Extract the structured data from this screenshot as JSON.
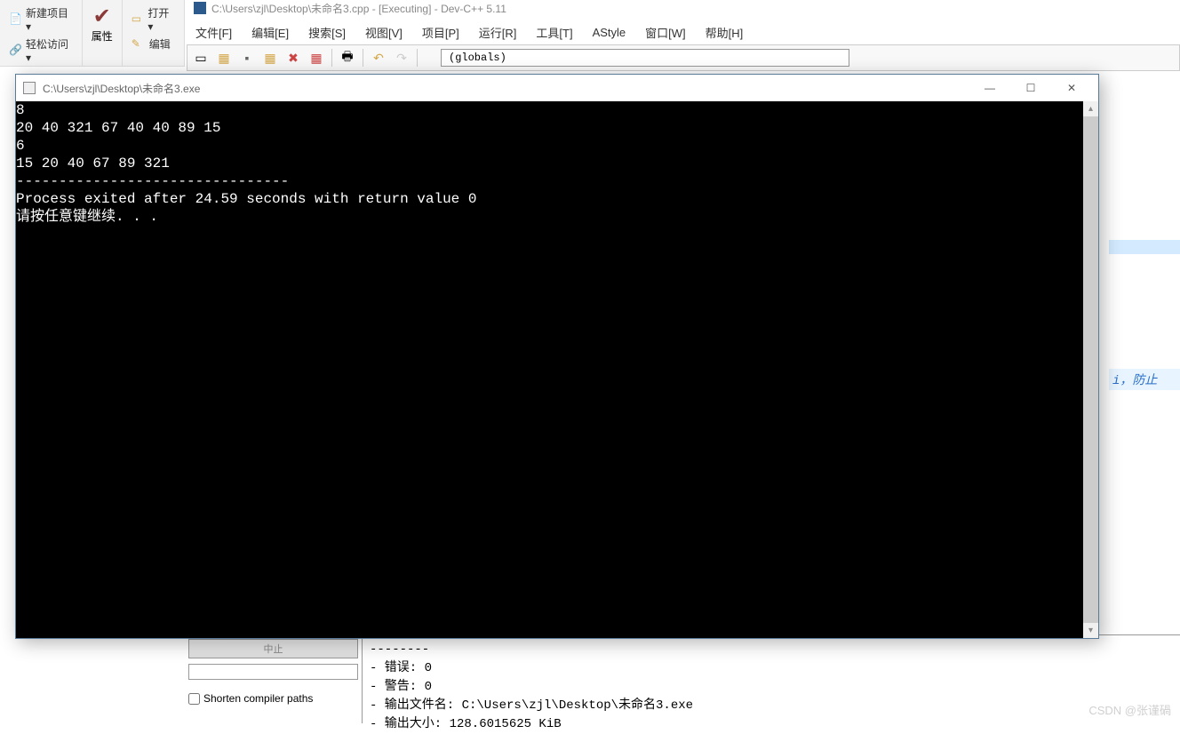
{
  "ide": {
    "title": "C:\\Users\\zjl\\Desktop\\未命名3.cpp - [Executing] - Dev-C++ 5.11",
    "ribbon": {
      "new_project": "新建项目 ▾",
      "quick_access": "轻松访问 ▾",
      "properties": "属性",
      "open": "打开 ▾",
      "edit": "编辑"
    },
    "menu": {
      "file": "文件[F]",
      "edit": "编辑[E]",
      "search": "搜索[S]",
      "view": "视图[V]",
      "project": "项目[P]",
      "run": "运行[R]",
      "tools": "工具[T]",
      "astyle": "AStyle",
      "window": "窗口[W]",
      "help": "帮助[H]"
    },
    "globals": "(globals)",
    "code_hint": "i，防止"
  },
  "console": {
    "title": "C:\\Users\\zjl\\Desktop\\未命名3.exe",
    "lines": [
      "8",
      "20 40 321 67 40 40 89 15",
      "6",
      "15 20 40 67 89 321",
      "--------------------------------",
      "Process exited after 24.59 seconds with return value 0",
      "请按任意键继续. . ."
    ]
  },
  "compiler": {
    "stop_label": "中止",
    "shorten_label": "Shorten compiler paths",
    "output_lines": [
      "--------",
      "- 错误: 0",
      "- 警告: 0",
      "- 输出文件名: C:\\Users\\zjl\\Desktop\\未命名3.exe",
      "- 输出大小: 128.6015625 KiB"
    ]
  },
  "watermark": "CSDN @张谨碢"
}
